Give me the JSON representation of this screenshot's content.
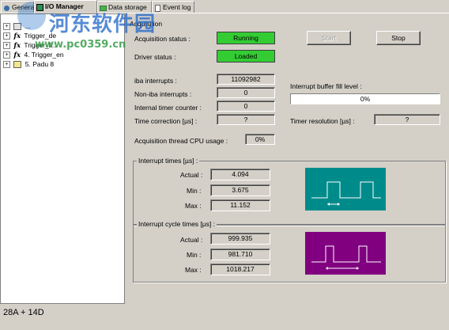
{
  "tabs": [
    {
      "label": "General"
    },
    {
      "label": "I/O Manager"
    },
    {
      "label": "Data storage"
    },
    {
      "label": "Event log"
    }
  ],
  "tree": {
    "items": [
      {
        "label": "..."
      },
      {
        "label": "Trigger_de"
      },
      {
        "label": "Trigger_fi..."
      },
      {
        "label": "4. Trigger_en"
      },
      {
        "label": "5. Padu 8"
      }
    ]
  },
  "bottom_label": "28A + 14D",
  "acquisition": {
    "section_title": "Acquisition",
    "status_label": "Acquisition status :",
    "status_value": "Running",
    "driver_label": "Driver status :",
    "driver_value": "Loaded",
    "start_button": "Start",
    "stop_button": "Stop",
    "iba_interrupts_label": "iba interrupts :",
    "iba_interrupts_value": "11092982",
    "non_iba_label": "Non-iba interrupts :",
    "non_iba_value": "0",
    "internal_timer_label": "Internal timer counter :",
    "internal_timer_value": "0",
    "time_correction_label": "Time correction [µs] :",
    "time_correction_value": "?",
    "buffer_label": "Interrupt buffer fill level :",
    "buffer_value": "0%",
    "timer_resolution_label": "Timer resolution  [µs] :",
    "timer_resolution_value": "?",
    "cpu_usage_label": "Acquisition thread CPU usage :",
    "cpu_usage_value": "0%"
  },
  "interrupt_times": {
    "title": "Interrupt times [µs] :",
    "actual_label": "Actual :",
    "actual_value": "4.094",
    "min_label": "Min :",
    "min_value": "3.675",
    "max_label": "Max :",
    "max_value": "11.152",
    "diagram_color": "#008b8b"
  },
  "interrupt_cycle_times": {
    "title": "Interrupt cycle times [µs] :",
    "actual_label": "Actual :",
    "actual_value": "999.935",
    "min_label": "Min :",
    "min_value": "981.710",
    "max_label": "Max :",
    "max_value": "1018.217",
    "diagram_color": "#800080"
  },
  "watermark": {
    "text_cn": "河东软件园",
    "url": "www.pc0359.cn"
  }
}
